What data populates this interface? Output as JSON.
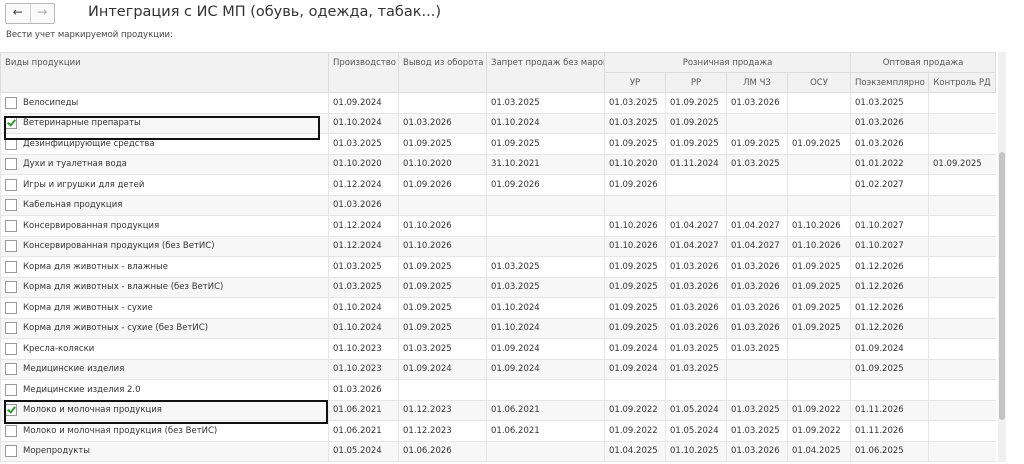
{
  "nav": {
    "back": "←",
    "forward": "→"
  },
  "title": "Интеграция с ИС МП (обувь, одежда, табак...)",
  "subtitle": "Вести учет маркируемой продукции:",
  "headers": {
    "name": "Виды продукции",
    "production": "Производство",
    "withdrawal": "Вывод из оборота",
    "ban": "Запрет продаж без марок",
    "retail_group": "Розничная продажа",
    "retail": [
      "УР",
      "РР",
      "ЛМ ЧЗ",
      "ОСУ"
    ],
    "wholesale_group": "Оптовая продажа",
    "wholesale": [
      "Поэкземплярно",
      "Контроль РД"
    ]
  },
  "rows": [
    {
      "name": "Велосипеды",
      "checked": false,
      "c": [
        "01.09.2024",
        "",
        "01.03.2025",
        "01.03.2025",
        "01.09.2025",
        "01.03.2026",
        "",
        "01.03.2025",
        ""
      ]
    },
    {
      "name": "Ветеринарные препараты",
      "checked": true,
      "c": [
        "01.10.2024",
        "01.03.2026",
        "01.10.2024",
        "01.03.2025",
        "01.09.2025",
        "",
        "",
        "01.03.2026",
        ""
      ]
    },
    {
      "name": "Дезинфицирующие средства",
      "checked": false,
      "c": [
        "01.03.2025",
        "01.09.2025",
        "01.09.2025",
        "01.09.2025",
        "01.09.2025",
        "01.09.2025",
        "01.09.2025",
        "01.03.2026",
        ""
      ]
    },
    {
      "name": "Духи и туалетная вода",
      "checked": false,
      "c": [
        "01.10.2020",
        "01.10.2020",
        "31.10.2021",
        "01.10.2020",
        "01.11.2024",
        "01.03.2025",
        "",
        "01.01.2022",
        "01.09.2025"
      ]
    },
    {
      "name": "Игры и игрушки для детей",
      "checked": false,
      "c": [
        "01.12.2024",
        "01.09.2026",
        "01.09.2026",
        "01.09.2026",
        "",
        "",
        "",
        "01.02.2027",
        ""
      ]
    },
    {
      "name": "Кабельная продукция",
      "checked": false,
      "c": [
        "01.03.2026",
        "",
        "",
        "",
        "",
        "",
        "",
        "",
        ""
      ]
    },
    {
      "name": "Консервированная продукция",
      "checked": false,
      "c": [
        "01.12.2024",
        "01.10.2026",
        "",
        "01.10.2026",
        "01.04.2027",
        "01.04.2027",
        "01.10.2026",
        "01.10.2027",
        ""
      ]
    },
    {
      "name": "Консервированная продукция (без ВетИС)",
      "checked": false,
      "c": [
        "01.12.2024",
        "01.10.2026",
        "",
        "01.10.2026",
        "01.04.2027",
        "01.04.2027",
        "01.10.2026",
        "01.10.2027",
        ""
      ]
    },
    {
      "name": "Корма для животных - влажные",
      "checked": false,
      "c": [
        "01.03.2025",
        "01.09.2025",
        "01.03.2025",
        "01.09.2025",
        "01.03.2026",
        "01.03.2026",
        "01.09.2025",
        "01.12.2026",
        ""
      ]
    },
    {
      "name": "Корма для животных - влажные (без ВетИС)",
      "checked": false,
      "c": [
        "01.03.2025",
        "01.09.2025",
        "01.03.2025",
        "01.09.2025",
        "01.03.2026",
        "01.03.2026",
        "01.09.2025",
        "01.12.2026",
        ""
      ]
    },
    {
      "name": "Корма для животных - сухие",
      "checked": false,
      "c": [
        "01.10.2024",
        "01.09.2025",
        "01.10.2024",
        "01.09.2025",
        "01.03.2026",
        "01.03.2026",
        "01.09.2025",
        "01.12.2026",
        ""
      ]
    },
    {
      "name": "Корма для животных - сухие (без ВетИС)",
      "checked": false,
      "c": [
        "01.10.2024",
        "01.09.2025",
        "01.10.2024",
        "01.09.2025",
        "01.03.2026",
        "01.03.2026",
        "01.09.2025",
        "01.12.2026",
        ""
      ]
    },
    {
      "name": "Кресла-коляски",
      "checked": false,
      "c": [
        "01.10.2023",
        "01.03.2025",
        "01.09.2024",
        "01.09.2024",
        "01.03.2025",
        "01.03.2025",
        "",
        "01.09.2024",
        ""
      ]
    },
    {
      "name": "Медицинские изделия",
      "checked": false,
      "c": [
        "01.10.2023",
        "01.09.2024",
        "01.09.2024",
        "01.09.2024",
        "01.03.2025",
        "",
        "",
        "01.09.2025",
        ""
      ]
    },
    {
      "name": "Медицинские изделия 2.0",
      "checked": false,
      "c": [
        "01.03.2026",
        "",
        "",
        "",
        "",
        "",
        "",
        "",
        ""
      ]
    },
    {
      "name": "Молоко и молочная продукция",
      "checked": true,
      "c": [
        "01.06.2021",
        "01.12.2023",
        "01.06.2021",
        "01.09.2022",
        "01.05.2024",
        "01.03.2025",
        "01.09.2022",
        "01.11.2026",
        ""
      ]
    },
    {
      "name": "Молоко и молочная продукция (без ВетИС)",
      "checked": false,
      "c": [
        "01.06.2021",
        "01.12.2023",
        "01.06.2021",
        "01.09.2022",
        "01.05.2024",
        "01.03.2025",
        "01.09.2022",
        "01.11.2026",
        ""
      ]
    },
    {
      "name": "Морепродукты",
      "checked": false,
      "c": [
        "01.05.2024",
        "01.06.2026",
        "",
        "01.04.2025",
        "01.10.2025",
        "01.03.2026",
        "01.04.2025",
        "01.06.2025",
        ""
      ]
    }
  ]
}
